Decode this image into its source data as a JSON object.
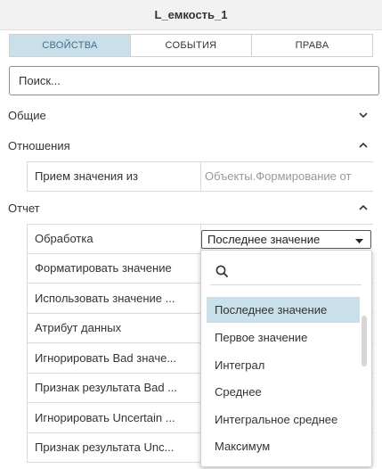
{
  "window": {
    "title": "L_емкость_1"
  },
  "tabs": [
    {
      "label": "СВОЙСТВА",
      "active": true
    },
    {
      "label": "СОБЫТИЯ",
      "active": false
    },
    {
      "label": "ПРАВА",
      "active": false
    }
  ],
  "search": {
    "placeholder": "Поиск..."
  },
  "sections": {
    "general": {
      "label": "Общие",
      "state": "collapsed",
      "icon": "chevron-down-icon"
    },
    "relations": {
      "label": "Отношения",
      "state": "expanded",
      "icon": "chevron-up-icon",
      "rows": [
        {
          "label": "Прием значения из",
          "value": "Объекты.Формирование от"
        }
      ]
    },
    "report": {
      "label": "Отчет",
      "state": "expanded",
      "icon": "chevron-up-icon",
      "rows": [
        {
          "label": "Обработка",
          "value": "Последнее значение"
        },
        {
          "label": "Форматировать значение",
          "value": ""
        },
        {
          "label": "Использовать значение ...",
          "value": ""
        },
        {
          "label": "Атрибут данных",
          "value": ""
        },
        {
          "label": "Игнорировать Bad значе...",
          "value": ""
        },
        {
          "label": "Признак результата Bad ...",
          "value": ""
        },
        {
          "label": "Игнорировать Uncertain ...",
          "value": ""
        },
        {
          "label": "Признак результата Unc...",
          "value": ""
        }
      ]
    }
  },
  "dropdown": {
    "search_icon": "search-icon",
    "options": [
      "Последнее значение",
      "Первое значение",
      "Интеграл",
      "Среднее",
      "Интегральное среднее",
      "Максимум"
    ],
    "selected": "Последнее значение"
  },
  "colors": {
    "accent": "#c9dfea",
    "accent_text": "#3f6f86",
    "header_bg": "#f2f2f2",
    "border": "#d9d9d9"
  }
}
